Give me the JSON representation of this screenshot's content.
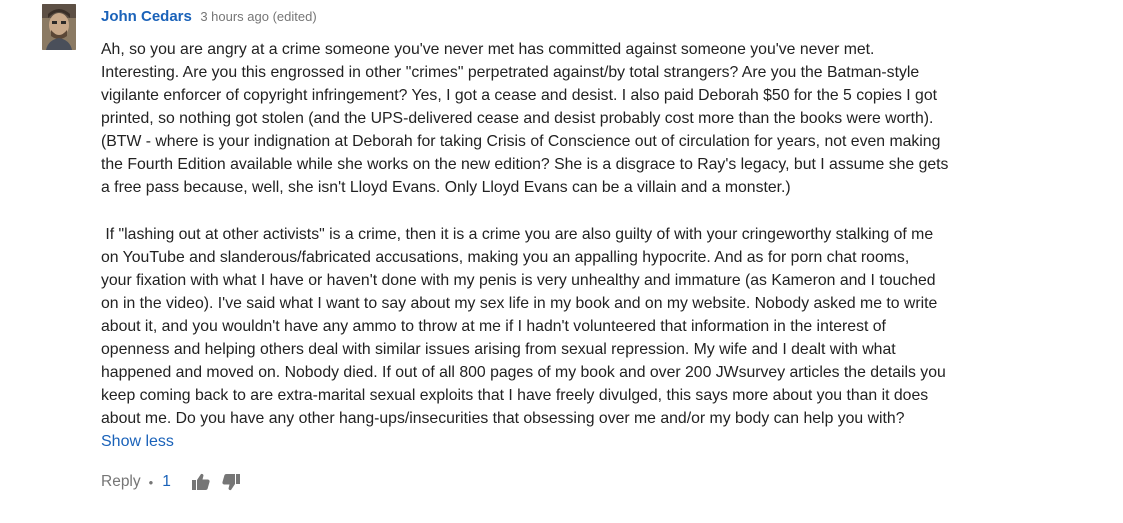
{
  "comment": {
    "author": "John Cedars",
    "time": "3 hours ago (edited)",
    "paragraph1": "Ah, so you are angry at a crime someone you've never met has committed against someone you've never met.\nInteresting. Are you this engrossed in other \"crimes\" perpetrated against/by total strangers? Are you the Batman-style\nvigilante enforcer of copyright infringement? Yes, I got a cease and desist. I also paid Deborah $50 for the 5 copies I got\nprinted, so nothing got stolen (and the UPS-delivered cease and desist probably cost more than the books were worth).\n(BTW - where is your indignation at Deborah for taking Crisis of Conscience out of circulation for years, not even making\nthe Fourth Edition available while she works on the new edition? She is a disgrace to Ray's legacy, but I assume she gets\na free pass because, well, she isn't Lloyd Evans. Only Lloyd Evans can be a villain and a monster.)",
    "paragraph2": " If \"lashing out at other activists\" is a crime, then it is a crime you are also guilty of with your cringeworthy stalking of me\non YouTube and slanderous/fabricated accusations, making you an appalling hypocrite. And as for porn chat rooms,\nyour fixation with what I have or haven't done with my penis is very unhealthy and immature (as Kameron and I touched\non in the video). I've said what I want to say about my sex life in my book and on my website. Nobody asked me to write\nabout it, and you wouldn't have any ammo to throw at me if I hadn't volunteered that information in the interest of\nopenness and helping others deal with similar issues arising from sexual repression. My wife and I dealt with what\nhappened and moved on. Nobody died. If out of all 800 pages of my book and over 200 JWsurvey articles the details you\nkeep coming back to are extra-marital sexual exploits that I have freely divulged, this says more about you than it does\nabout me. Do you have any other hang-ups/insecurities that obsessing over me and/or my body can help you with?",
    "show_less": "Show less"
  },
  "actions": {
    "reply": "Reply",
    "separator": "•",
    "like_count": "1",
    "like_icon": "thumbs-up-icon",
    "dislike_icon": "thumbs-down-icon"
  },
  "colors": {
    "link": "#1a62b9",
    "meta": "#767676",
    "text": "#222222"
  }
}
